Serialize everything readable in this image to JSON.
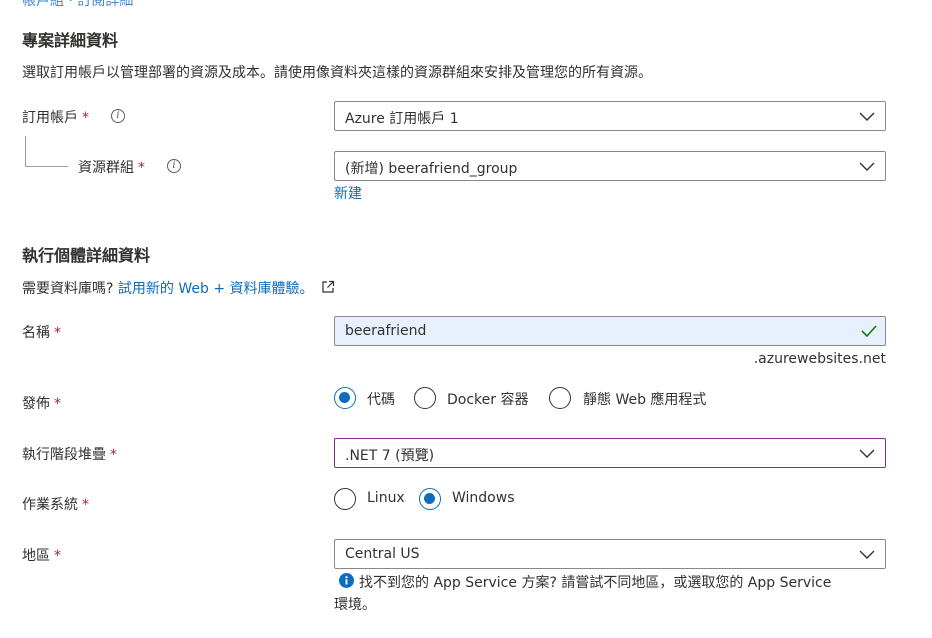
{
  "breadcrumb_partial": "帳戶組 · 訂閱詳細",
  "project": {
    "heading": "專案詳細資料",
    "description": "選取訂用帳戶以管理部署的資源及成本。請使用像資料夾這樣的資源群組來安排及管理您的所有資源。",
    "subscription": {
      "label": "訂用帳戶",
      "required": "*",
      "value": "Azure 訂用帳戶 1"
    },
    "resource_group": {
      "label": "資源群組",
      "required": "*",
      "value": "(新增) beerafriend_group",
      "new_link": "新建"
    }
  },
  "instance": {
    "heading": "執行個體詳細資料",
    "db_prompt": "需要資料庫嗎?",
    "db_link": "試用新的 Web + 資料庫體驗。",
    "name": {
      "label": "名稱",
      "required": "*",
      "value": "beerafriend",
      "suffix": ".azurewebsites.net"
    },
    "publish": {
      "label": "發佈",
      "required": "*",
      "options": [
        "代碼",
        "Docker 容器",
        "靜態 Web 應用程式"
      ],
      "selected": "代碼"
    },
    "runtime": {
      "label": "執行階段堆疊",
      "required": "*",
      "value": ".NET 7 (預覽)"
    },
    "os": {
      "label": "作業系統",
      "required": "*",
      "options": [
        "Linux",
        "Windows"
      ],
      "selected": "Windows"
    },
    "region": {
      "label": "地區",
      "required": "*",
      "value": "Central US",
      "info_line1": "找不到您的 App Service 方案? 請嘗試不同地區，或選取您的 App Service",
      "info_line2": "環境。"
    }
  },
  "colors": {
    "accent": "#0f6cbd",
    "required": "#a4262c",
    "valid": "#107c10",
    "focus_border": "#8a2b8a"
  }
}
